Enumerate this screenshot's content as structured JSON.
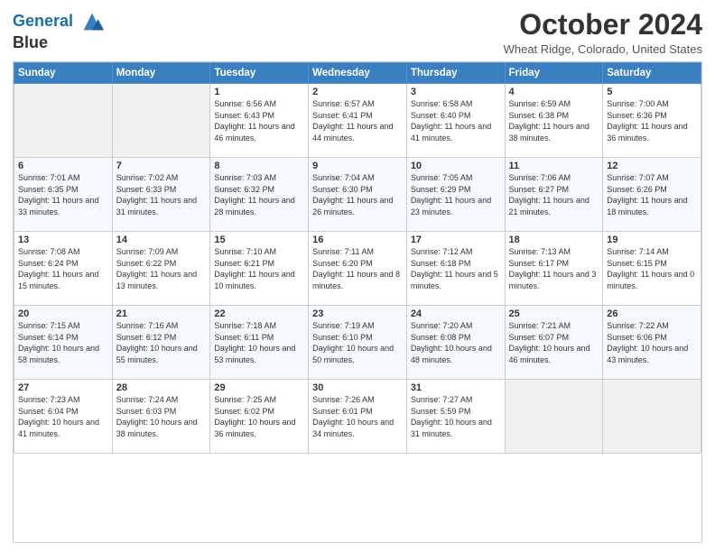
{
  "header": {
    "logo_line1": "General",
    "logo_line2": "Blue",
    "title": "October 2024",
    "subtitle": "Wheat Ridge, Colorado, United States"
  },
  "days_of_week": [
    "Sunday",
    "Monday",
    "Tuesday",
    "Wednesday",
    "Thursday",
    "Friday",
    "Saturday"
  ],
  "weeks": [
    [
      {
        "day": "",
        "info": ""
      },
      {
        "day": "",
        "info": ""
      },
      {
        "day": "1",
        "info": "Sunrise: 6:56 AM\nSunset: 6:43 PM\nDaylight: 11 hours and 46 minutes."
      },
      {
        "day": "2",
        "info": "Sunrise: 6:57 AM\nSunset: 6:41 PM\nDaylight: 11 hours and 44 minutes."
      },
      {
        "day": "3",
        "info": "Sunrise: 6:58 AM\nSunset: 6:40 PM\nDaylight: 11 hours and 41 minutes."
      },
      {
        "day": "4",
        "info": "Sunrise: 6:59 AM\nSunset: 6:38 PM\nDaylight: 11 hours and 38 minutes."
      },
      {
        "day": "5",
        "info": "Sunrise: 7:00 AM\nSunset: 6:36 PM\nDaylight: 11 hours and 36 minutes."
      }
    ],
    [
      {
        "day": "6",
        "info": "Sunrise: 7:01 AM\nSunset: 6:35 PM\nDaylight: 11 hours and 33 minutes."
      },
      {
        "day": "7",
        "info": "Sunrise: 7:02 AM\nSunset: 6:33 PM\nDaylight: 11 hours and 31 minutes."
      },
      {
        "day": "8",
        "info": "Sunrise: 7:03 AM\nSunset: 6:32 PM\nDaylight: 11 hours and 28 minutes."
      },
      {
        "day": "9",
        "info": "Sunrise: 7:04 AM\nSunset: 6:30 PM\nDaylight: 11 hours and 26 minutes."
      },
      {
        "day": "10",
        "info": "Sunrise: 7:05 AM\nSunset: 6:29 PM\nDaylight: 11 hours and 23 minutes."
      },
      {
        "day": "11",
        "info": "Sunrise: 7:06 AM\nSunset: 6:27 PM\nDaylight: 11 hours and 21 minutes."
      },
      {
        "day": "12",
        "info": "Sunrise: 7:07 AM\nSunset: 6:26 PM\nDaylight: 11 hours and 18 minutes."
      }
    ],
    [
      {
        "day": "13",
        "info": "Sunrise: 7:08 AM\nSunset: 6:24 PM\nDaylight: 11 hours and 15 minutes."
      },
      {
        "day": "14",
        "info": "Sunrise: 7:09 AM\nSunset: 6:22 PM\nDaylight: 11 hours and 13 minutes."
      },
      {
        "day": "15",
        "info": "Sunrise: 7:10 AM\nSunset: 6:21 PM\nDaylight: 11 hours and 10 minutes."
      },
      {
        "day": "16",
        "info": "Sunrise: 7:11 AM\nSunset: 6:20 PM\nDaylight: 11 hours and 8 minutes."
      },
      {
        "day": "17",
        "info": "Sunrise: 7:12 AM\nSunset: 6:18 PM\nDaylight: 11 hours and 5 minutes."
      },
      {
        "day": "18",
        "info": "Sunrise: 7:13 AM\nSunset: 6:17 PM\nDaylight: 11 hours and 3 minutes."
      },
      {
        "day": "19",
        "info": "Sunrise: 7:14 AM\nSunset: 6:15 PM\nDaylight: 11 hours and 0 minutes."
      }
    ],
    [
      {
        "day": "20",
        "info": "Sunrise: 7:15 AM\nSunset: 6:14 PM\nDaylight: 10 hours and 58 minutes."
      },
      {
        "day": "21",
        "info": "Sunrise: 7:16 AM\nSunset: 6:12 PM\nDaylight: 10 hours and 55 minutes."
      },
      {
        "day": "22",
        "info": "Sunrise: 7:18 AM\nSunset: 6:11 PM\nDaylight: 10 hours and 53 minutes."
      },
      {
        "day": "23",
        "info": "Sunrise: 7:19 AM\nSunset: 6:10 PM\nDaylight: 10 hours and 50 minutes."
      },
      {
        "day": "24",
        "info": "Sunrise: 7:20 AM\nSunset: 6:08 PM\nDaylight: 10 hours and 48 minutes."
      },
      {
        "day": "25",
        "info": "Sunrise: 7:21 AM\nSunset: 6:07 PM\nDaylight: 10 hours and 46 minutes."
      },
      {
        "day": "26",
        "info": "Sunrise: 7:22 AM\nSunset: 6:06 PM\nDaylight: 10 hours and 43 minutes."
      }
    ],
    [
      {
        "day": "27",
        "info": "Sunrise: 7:23 AM\nSunset: 6:04 PM\nDaylight: 10 hours and 41 minutes."
      },
      {
        "day": "28",
        "info": "Sunrise: 7:24 AM\nSunset: 6:03 PM\nDaylight: 10 hours and 38 minutes."
      },
      {
        "day": "29",
        "info": "Sunrise: 7:25 AM\nSunset: 6:02 PM\nDaylight: 10 hours and 36 minutes."
      },
      {
        "day": "30",
        "info": "Sunrise: 7:26 AM\nSunset: 6:01 PM\nDaylight: 10 hours and 34 minutes."
      },
      {
        "day": "31",
        "info": "Sunrise: 7:27 AM\nSunset: 5:59 PM\nDaylight: 10 hours and 31 minutes."
      },
      {
        "day": "",
        "info": ""
      },
      {
        "day": "",
        "info": ""
      }
    ]
  ]
}
